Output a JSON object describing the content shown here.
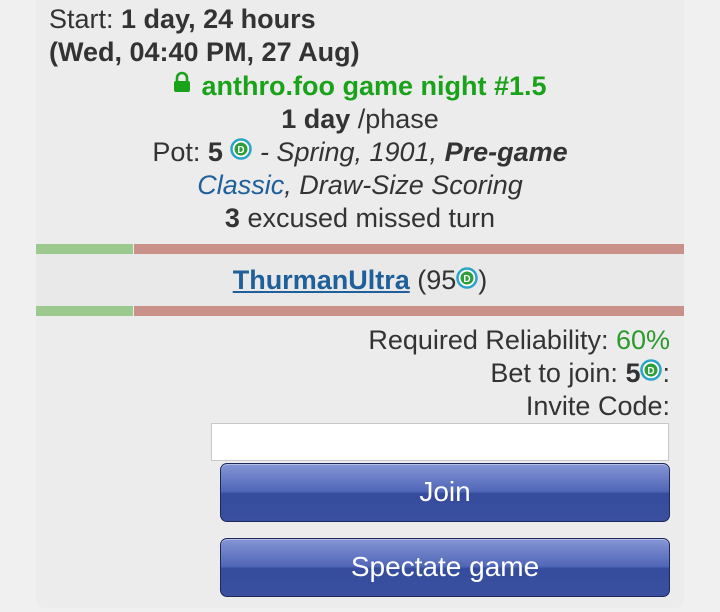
{
  "game": {
    "start_prefix": "Start: ",
    "start_value": "1 day, 24 hours",
    "start_date": "(Wed, 04:40 PM, 27 Aug)",
    "title": "anthro.foo game night #1.5",
    "phase_value": "1 day",
    "phase_suffix": " /phase",
    "pot_label": "Pot: ",
    "pot_value": "5",
    "season": " - Spring, 1901, ",
    "stage": "Pre-game",
    "variant": "Classic",
    "scoring": ", Draw-Size Scoring",
    "excused_count": "3",
    "excused_text": " excused missed turn"
  },
  "player": {
    "name": "ThurmanUltra",
    "points_open": "(95",
    "points_close": ")"
  },
  "join_panel": {
    "reliability_label": "Required Reliability: ",
    "reliability_value": "60%",
    "bet_label": "Bet to join: ",
    "bet_value": "5",
    "bet_suffix": ":",
    "invite_label": "Invite Code:",
    "invite_value": "",
    "join_label": "Join",
    "spectate_label": "Spectate game"
  },
  "colors": {
    "accent_green": "#1aa21a",
    "link_blue": "#1f5f9a",
    "button_blue": "#3a4fa0",
    "bar_green": "#9cc98e",
    "bar_red": "#c9918a"
  },
  "icons": {
    "lock": "lock-icon",
    "coin": "dippy-point-icon"
  }
}
